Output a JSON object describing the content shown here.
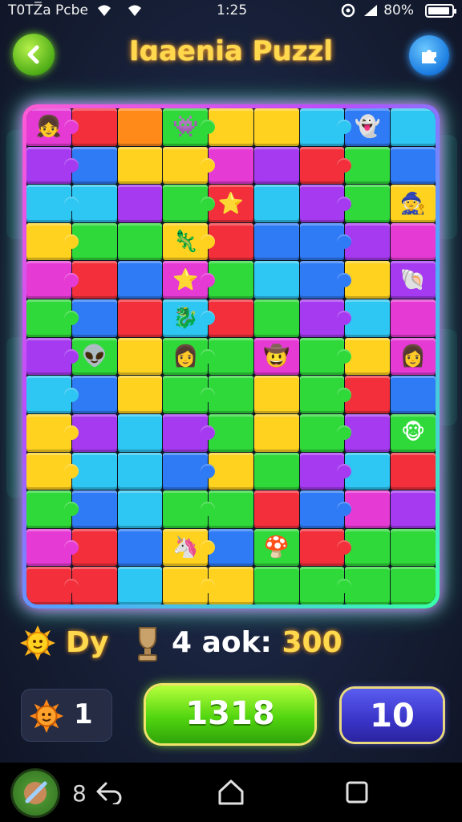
{
  "status_bar": {
    "left_text": "T0TZ̅a Pcbe",
    "time": "1:25",
    "battery": "80%"
  },
  "header": {
    "title": "Iɑaenia Puzzl",
    "back_icon": "chevron-left-icon",
    "right_icon": "puzzle-settings-icon"
  },
  "board": {
    "columns": 9,
    "rows": 13,
    "palette": {
      "R": "#f22f3a",
      "Y": "#ffd21f",
      "G": "#2fd93a",
      "B": "#2f7af5",
      "C": "#2ec6f2",
      "P": "#a63af0",
      "M": "#e63ad4",
      "O": "#ff8a1a"
    },
    "pieces": [
      "M",
      "R",
      "O",
      "G",
      "Y",
      "Y",
      "C",
      "B",
      "C",
      "P",
      "B",
      "Y",
      "Y",
      "M",
      "P",
      "R",
      "G",
      "B",
      "C",
      "C",
      "P",
      "G",
      "R",
      "C",
      "P",
      "G",
      "Y",
      "Y",
      "G",
      "G",
      "Y",
      "R",
      "B",
      "B",
      "P",
      "M",
      "M",
      "R",
      "B",
      "M",
      "G",
      "C",
      "B",
      "Y",
      "P",
      "G",
      "B",
      "R",
      "C",
      "R",
      "G",
      "P",
      "C",
      "M",
      "P",
      "G",
      "Y",
      "G",
      "G",
      "M",
      "G",
      "Y",
      "M",
      "C",
      "B",
      "Y",
      "G",
      "G",
      "Y",
      "G",
      "R",
      "B",
      "Y",
      "P",
      "C",
      "P",
      "G",
      "Y",
      "G",
      "P",
      "G",
      "Y",
      "C",
      "C",
      "B",
      "Y",
      "G",
      "P",
      "C",
      "R",
      "G",
      "B",
      "C",
      "G",
      "G",
      "R",
      "B",
      "M",
      "P",
      "M",
      "R",
      "B",
      "Y",
      "B",
      "G",
      "R",
      "G",
      "G",
      "R",
      "R",
      "C",
      "Y",
      "Y",
      "G",
      "G",
      "G",
      "G"
    ],
    "characters": [
      {
        "index": 0,
        "glyph": "👧"
      },
      {
        "index": 3,
        "glyph": "👾"
      },
      {
        "index": 7,
        "glyph": "👻"
      },
      {
        "index": 22,
        "glyph": "⭐"
      },
      {
        "index": 26,
        "glyph": "🧙"
      },
      {
        "index": 30,
        "glyph": "🦎"
      },
      {
        "index": 44,
        "glyph": "🦴"
      },
      {
        "index": 48,
        "glyph": "🐉"
      },
      {
        "index": 39,
        "glyph": "⭐"
      },
      {
        "index": 44,
        "glyph": "🐚"
      },
      {
        "index": 55,
        "glyph": "👽"
      },
      {
        "index": 57,
        "glyph": "👩"
      },
      {
        "index": 59,
        "glyph": "🤠"
      },
      {
        "index": 62,
        "glyph": "👩"
      },
      {
        "index": 80,
        "glyph": "🐵"
      },
      {
        "index": 102,
        "glyph": "🦄"
      },
      {
        "index": 104,
        "glyph": "🍄"
      }
    ]
  },
  "score_row": {
    "sun_icon": "sun-face-icon",
    "label": "Dy",
    "trophy_icon": "trophy-icon",
    "score_prefix": "4 aok:",
    "score_value": "300"
  },
  "bottom": {
    "lives_icon": "sun-face-icon",
    "lives_value": "1",
    "green_button_label": "1318",
    "blue_button_label": "10"
  },
  "nav_bar": {
    "app_icon": "game-app-icon",
    "number": "8",
    "back_icon": "back-arrow-icon",
    "home_icon": "home-icon",
    "recents_icon": "recents-icon"
  }
}
